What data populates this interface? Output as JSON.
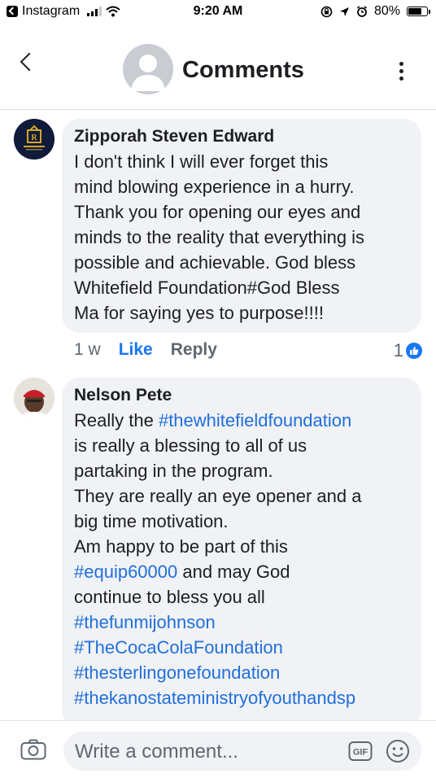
{
  "status_bar": {
    "back_app": "Instagram",
    "time": "9:20 AM",
    "battery": "80%",
    "battery_level": 0.8
  },
  "header": {
    "title": "Comments"
  },
  "comments": [
    {
      "author": "Zipporah Steven Edward",
      "lines": [
        "I don't think I will ever forget this",
        "mind blowing experience in a hurry.",
        "Thank you for opening our eyes and",
        "minds to the reality that everything is",
        "possible and achievable. God bless",
        "Whitefield Foundation#God Bless",
        "Ma for saying yes to purpose!!!!"
      ],
      "time": "1 w",
      "like_label": "Like",
      "reply_label": "Reply",
      "reaction_count": "1"
    },
    {
      "author": "Nelson Pete",
      "line1_prefix": "Really the ",
      "line1_tag": "#thewhitefieldfoundation",
      "lines_mid": [
        "is really a blessing to all of us",
        "partaking in the program.",
        "They are really an eye opener and a",
        "big time motivation.",
        "Am happy to be part of this"
      ],
      "tag_equip": "#equip60000",
      "equip_suffix": " and may God",
      "line_continue": "continue to bless you all",
      "tags": [
        "#thefunmijohnson",
        "#TheCocaColaFoundation",
        "#thesterlingonefoundation",
        "#thekanostateministryofyouthandsp"
      ]
    }
  ],
  "composer": {
    "placeholder": "Write a comment...",
    "gif_label": "GIF"
  }
}
